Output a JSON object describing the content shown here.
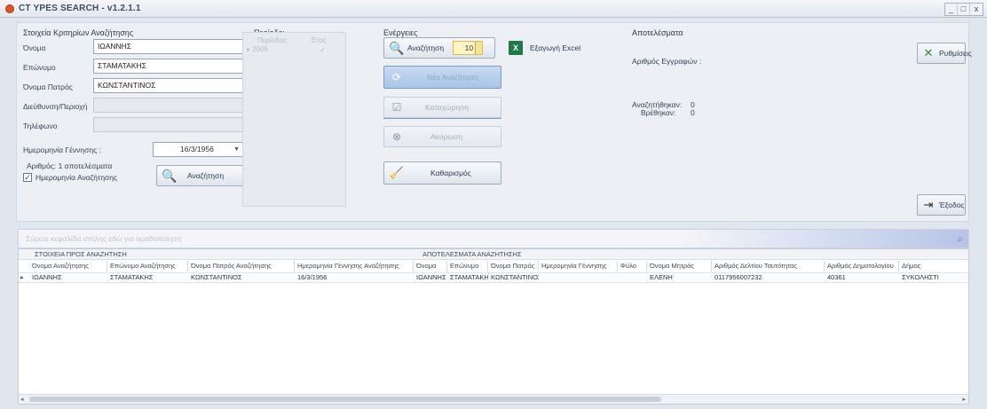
{
  "window": {
    "title": "CT YPES SEARCH - v1.2.1.1",
    "min": "_",
    "max": "□",
    "close": "x"
  },
  "criteria": {
    "title": "Στοιχεία Κριτηρίων Αναζήτησης",
    "name_label": "Όνομα",
    "name_value": "ΙΩΑΝΝΗΣ",
    "surname_label": "Επώνυμο",
    "surname_value": "ΣΤΑΜΑΤΑΚΗΣ",
    "father_label": "Όνομα Πατρός",
    "father_value": "ΚΩΝΣΤΑΝΤΙΝΟΣ",
    "ident_label": "Διεύθυνση/Περιοχή",
    "phone_label": "Τηλέφωνο",
    "birth_label": "Ημερομηνία Γέννησης :",
    "birth_value": "16/3/1956",
    "results_count": "Αριθμός: 1 αποτελέσματα",
    "advanced_label": "Ημερομηνία Αναζήτησης",
    "advanced_checked": true,
    "search_btn": "Αναζήτηση"
  },
  "periodos": {
    "title": "Περίοδοι",
    "col1": "Περίοδος",
    "col2": "Έτος",
    "row": "2005"
  },
  "actions": {
    "title": "Ενέργειες",
    "search_btn": "Αναζήτηση",
    "spin_value": "10",
    "excel_btn": "Εξαγωγή Excel",
    "btn2": "Νέα Αναζήτηση",
    "btn3": "Καταχώρηση",
    "btn4": "Ακύρωση",
    "clear_btn": "Καθαρισμός"
  },
  "results": {
    "title": "Αποτελέσματα",
    "records_label": "Αριθμός Εγγραφών :",
    "found_label": "Αναζητήθηκαν:",
    "found_value": "0",
    "found2_label": "Βρέθηκαν:",
    "found2_value": "0"
  },
  "right": {
    "settings_btn": "Ρυθμίσεις",
    "exit_btn": "Έξοδος"
  },
  "grid": {
    "search_placeholder": "Σύρετε κεφαλίδα στήλης εδώ για ομαδοποίηση",
    "group1": "ΣΤΟΙΧΕΙΑ ΠΡΟΣ ΑΝΑΖΗΤΗΣΗ",
    "group2": "ΑΠΟΤΕΛΕΣΜΑΤΑ ΑΝΑΖΗΤΗΣΗΣ",
    "columns": [
      "Όνομα Αναζήτησης",
      "Επώνυμο Αναζήτησης",
      "Όνομα Πατρός Αναζήτησης",
      "Ημερομηνία Γέννησης Αναζήτησης",
      "Όνομα",
      "Επώνυμο",
      "Όνομα Πατρός",
      "Ημερομηνία Γέννησης",
      "Φύλο",
      "Όνομα Μητρός",
      "Αριθμός Δελτίου Ταυτότητας",
      "Αριθμός Δημοτολογίου",
      "Δήμος"
    ],
    "row": [
      "ΙΩΑΝΝΗΣ",
      "ΣΤΑΜΑΤΑΚΗΣ",
      "ΚΩΝΣΤΑΝΤΙΝΟΣ",
      "16/3/1956",
      "ΙΩΑΝΝΗΣ",
      "ΣΤΑΜΑΤΑΚΗΣ",
      "ΚΩΝΣΤΑΝΤΙΝΟΣ",
      "",
      "",
      "ΕΛΕΝΗ",
      "0117956007232",
      "40361",
      "ΣΥΚΟΛΗΣΤΙ"
    ]
  }
}
